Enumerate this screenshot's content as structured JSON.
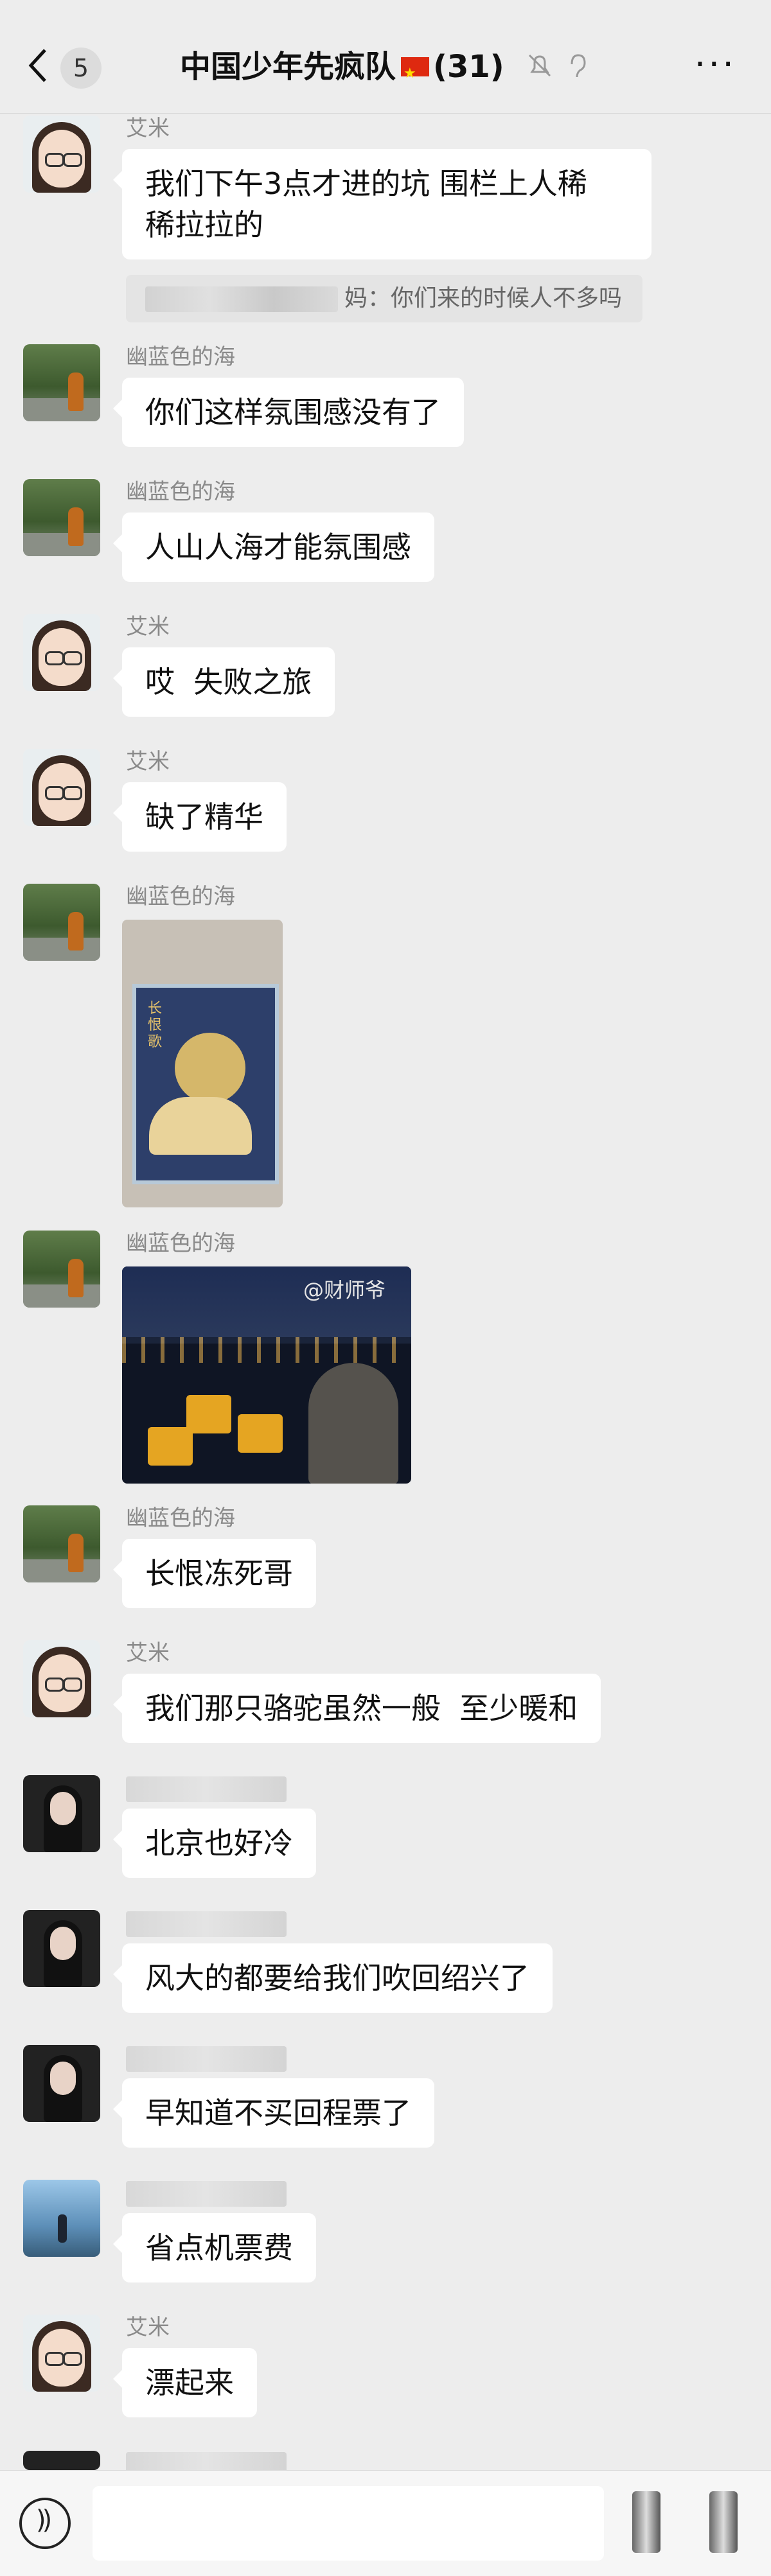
{
  "header": {
    "back_count": "5",
    "title": "中国少年先疯队",
    "member_count": "(31)",
    "icons": [
      "back-icon",
      "mute-bell-icon",
      "ear-icon",
      "more-icon"
    ]
  },
  "messages": [
    {
      "sender": "艾米",
      "avatar": "anime-girl",
      "lines": [
        "我们下午3点才进的坑 围栏上人稀",
        "稀拉拉的"
      ]
    },
    {
      "quote_text": "妈：你们来的时候人不多吗"
    },
    {
      "sender": "幽蓝色的海",
      "avatar": "sea",
      "text": "你们这样氛围感没有了"
    },
    {
      "sender": "幽蓝色的海",
      "avatar": "sea",
      "text": "人山人海才能氛围感"
    },
    {
      "sender": "艾米",
      "avatar": "anime-girl",
      "text": "哎  失败之旅"
    },
    {
      "sender": "艾米",
      "avatar": "anime-girl",
      "text": "缺了精华"
    },
    {
      "sender": "幽蓝色的海",
      "avatar": "sea",
      "image": "photo-card",
      "image_text": "长恨歌"
    },
    {
      "sender": "幽蓝色的海",
      "avatar": "sea",
      "image": "photo-night",
      "watermark": "@财师爷"
    },
    {
      "sender": "幽蓝色的海",
      "avatar": "sea",
      "text": "长恨冻死哥"
    },
    {
      "sender": "艾米",
      "avatar": "anime-girl",
      "text": "我们那只骆驼虽然一般  至少暖和"
    },
    {
      "sender": "",
      "avatar": "dark-girl",
      "text": "北京也好冷"
    },
    {
      "sender": "",
      "avatar": "dark-girl",
      "text": "风大的都要给我们吹回绍兴了"
    },
    {
      "sender": "",
      "avatar": "dark-girl",
      "text": "早知道不买回程票了"
    },
    {
      "sender": "",
      "avatar": "blue-sky",
      "text": "省点机票费"
    },
    {
      "sender": "艾米",
      "avatar": "anime-girl",
      "text": "漂起来"
    }
  ],
  "bottom": {
    "icons": [
      "voice-icon",
      "sticker-icon",
      "plus-icon"
    ]
  }
}
